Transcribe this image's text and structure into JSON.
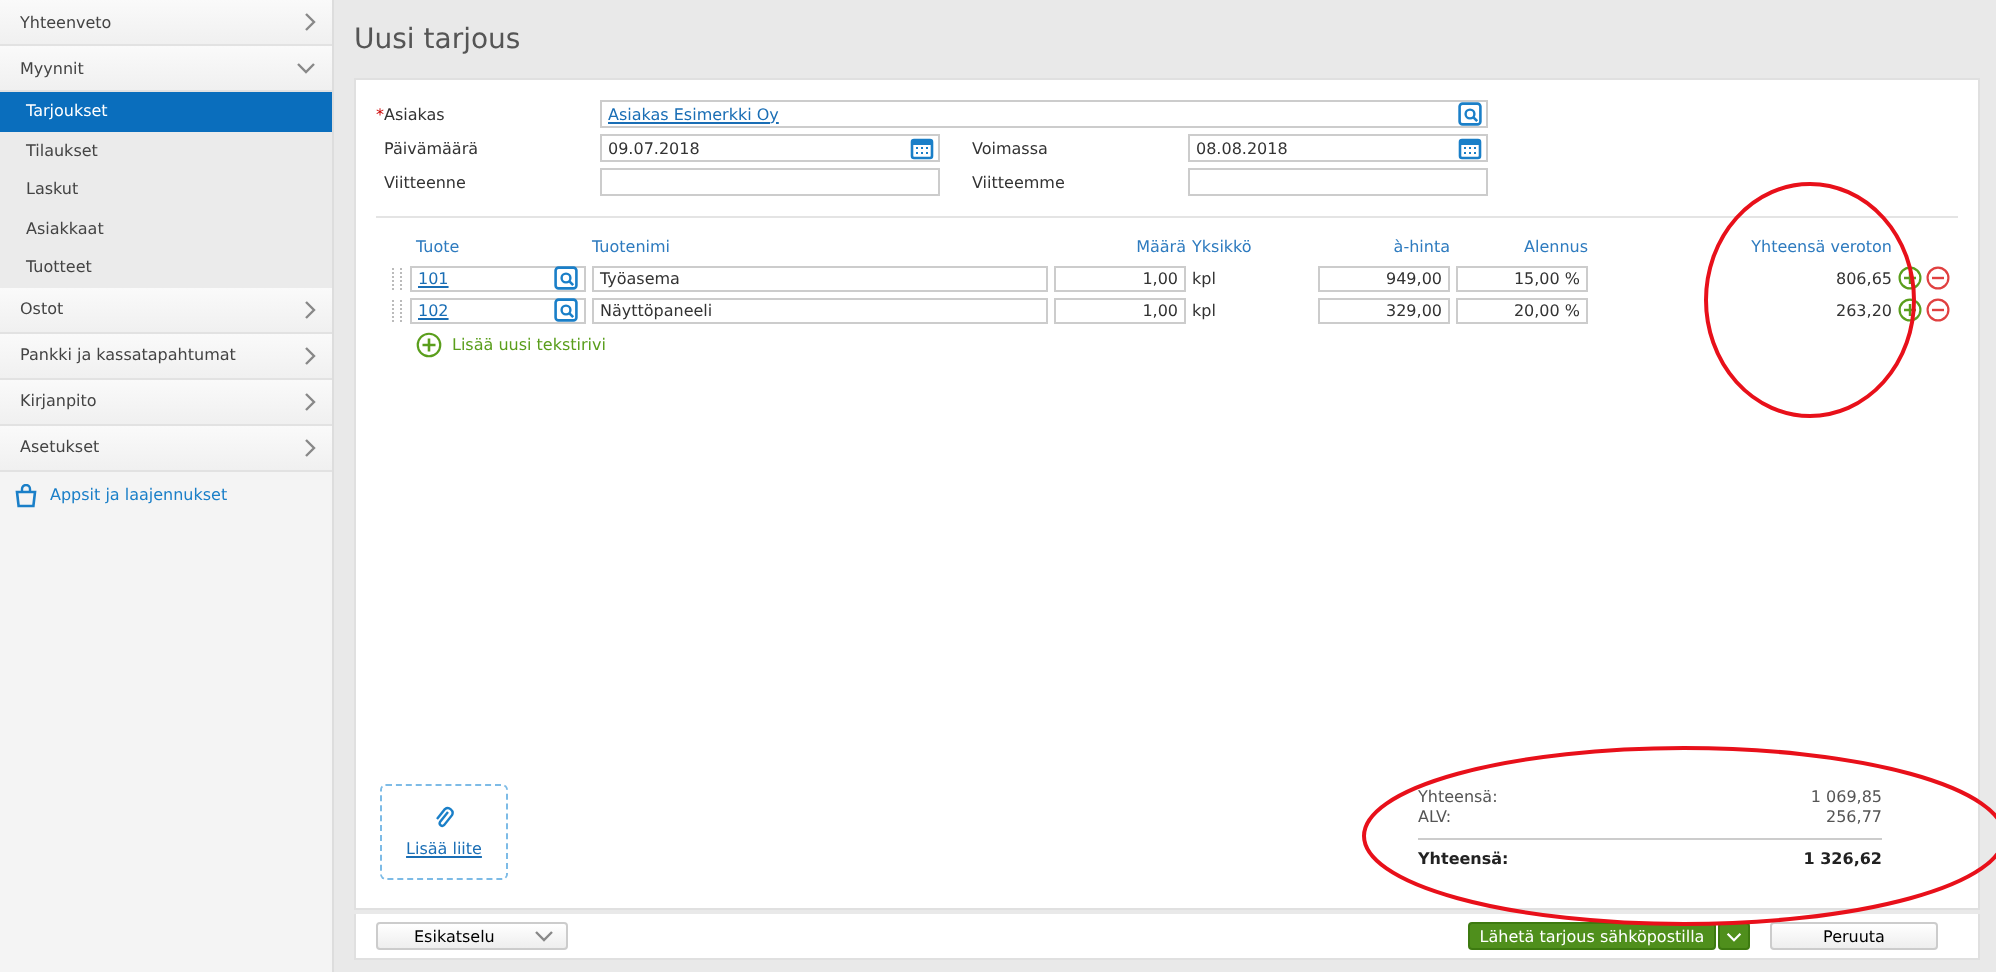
{
  "sidebar": {
    "items": [
      {
        "label": "Yhteenveto",
        "expanded": false
      },
      {
        "label": "Myynnit",
        "expanded": true,
        "children": [
          {
            "label": "Tarjoukset",
            "selected": true
          },
          {
            "label": "Tilaukset",
            "selected": false
          },
          {
            "label": "Laskut",
            "selected": false
          },
          {
            "label": "Asiakkaat",
            "selected": false
          },
          {
            "label": "Tuotteet",
            "selected": false
          }
        ]
      },
      {
        "label": "Ostot",
        "expanded": false
      },
      {
        "label": "Pankki ja kassatapahtumat",
        "expanded": false
      },
      {
        "label": "Kirjanpito",
        "expanded": false
      },
      {
        "label": "Asetukset",
        "expanded": false
      }
    ],
    "apps_link": "Appsit ja laajennukset"
  },
  "page_title": "Uusi tarjous",
  "customer": {
    "label": "Asiakas",
    "required_mark": "*",
    "value": "Asiakas Esimerkki Oy"
  },
  "fields": [
    {
      "label": "Päivämäärä",
      "value": "09.07.2018",
      "kind": "date"
    },
    {
      "label": "Voimassa",
      "value": "08.08.2018",
      "kind": "date"
    },
    {
      "label": "Viitteenne",
      "kind": "text"
    },
    {
      "label": "Viitteemme",
      "kind": "text"
    }
  ],
  "table": {
    "columns": [
      "Tuote",
      "Tuotenimi",
      "Määrä",
      "Yksikkö",
      "à-hinta",
      "Alennus",
      "Yhteensä veroton"
    ],
    "rows": [
      {
        "product": "101",
        "name": "Työasema",
        "quantity": "1,00",
        "unit": "kpl",
        "price": "949,00",
        "discount": "15,00 %",
        "total": "806,65"
      },
      {
        "product": "102",
        "name": "Näyttöpaneeli",
        "quantity": "1,00",
        "unit": "kpl",
        "price": "329,00",
        "discount": "20,00 %",
        "total": "263,20"
      }
    ],
    "add_row": "Lisää uusi tekstirivi"
  },
  "attachment": "Lisää liite",
  "totals": [
    {
      "label": "Yhteensä:",
      "value": "1 069,85",
      "bold": false
    },
    {
      "label": "ALV:",
      "value": "256,77",
      "bold": false
    },
    {
      "label": "Yhteensä:",
      "value": "1 326,62",
      "bold": true
    }
  ],
  "footer": {
    "preview": "Esikatselu",
    "send": "Lähetä tarjous sähköpostilla",
    "cancel": "Peruuta"
  },
  "annotations": [
    {
      "kind": "ellipse"
    },
    {
      "kind": "ellipse"
    }
  ]
}
